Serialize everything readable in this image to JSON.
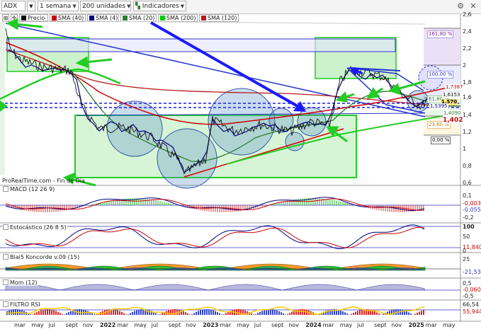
{
  "toolbar": {
    "symbol": "ADX",
    "period": "1 semana",
    "units": "200 unidades",
    "indicators": "Indicadores"
  },
  "legend": [
    {
      "label": "Precio",
      "color": "#000000"
    },
    {
      "label": "SMA (40)",
      "color": "#cc0000"
    },
    {
      "label": "SMA (4)",
      "color": "#000080"
    },
    {
      "label": "SMA (20)",
      "color": "#2e7d32"
    },
    {
      "label": "SMA (200)",
      "color": "#00cc00"
    },
    {
      "label": "SMA (120)",
      "color": "#b71c1c"
    }
  ],
  "footer": "ProRealTime.com - Fin de Día",
  "panels": {
    "macd": "MACD (12 26 9)",
    "stoch": "Estocástico (26 8 5)",
    "blai5": "Blai5 Koncorde v.09 (15)",
    "mom": "Mom (12)",
    "filtro": "FILTRO RSI"
  },
  "price_axis": [
    "2,6",
    "2,4",
    "2,2",
    "2",
    "1,8",
    "1,6",
    "1,4",
    "1,2",
    "1",
    "0,8",
    "0,6"
  ],
  "price_tags": [
    {
      "text": "1,7387",
      "color": "#cc0000",
      "bg": "#ffffff"
    },
    {
      "text": "1,6153",
      "color": "#000000",
      "bg": "#ffffff"
    },
    {
      "text": "1,570",
      "color": "#000000",
      "bg": "#ffe680"
    },
    {
      "text": "1,5395",
      "color": "#000080",
      "bg": "#ffffff"
    },
    {
      "text": "1,4090",
      "color": "#2e7d32",
      "bg": "#ffffff"
    },
    {
      "text": "1,402",
      "color": "#cc0000",
      "bg": "#ffffff"
    }
  ],
  "fib_levels": [
    "161,80 %",
    "100,00 %",
    "61,80 %",
    "23,60 %",
    "0,00 %"
  ],
  "macd_axis": [
    "0,1",
    "-0,0032",
    "-0,0558",
    "-0,2"
  ],
  "stoch_axis": [
    "100",
    "50",
    "11,840",
    "0"
  ],
  "blai5_axis": [
    "25",
    "-21,538"
  ],
  "mom_axis": [
    "0,5",
    "-0,0600",
    "-0,5"
  ],
  "filtro_axis": [
    "66,54",
    "55,944"
  ],
  "x_axis": [
    {
      "label": "mar",
      "year": false
    },
    {
      "label": "may",
      "year": false
    },
    {
      "label": "jul",
      "year": false
    },
    {
      "label": "sept",
      "year": false
    },
    {
      "label": "nov",
      "year": false
    },
    {
      "label": "2022",
      "year": true
    },
    {
      "label": "mar",
      "year": false
    },
    {
      "label": "may",
      "year": false
    },
    {
      "label": "jul",
      "year": false
    },
    {
      "label": "sept",
      "year": false
    },
    {
      "label": "nov",
      "year": false
    },
    {
      "label": "2023",
      "year": true
    },
    {
      "label": "mar",
      "year": false
    },
    {
      "label": "may",
      "year": false
    },
    {
      "label": "jul",
      "year": false
    },
    {
      "label": "sept",
      "year": false
    },
    {
      "label": "nov",
      "year": false
    },
    {
      "label": "2024",
      "year": true
    },
    {
      "label": "mar",
      "year": false
    },
    {
      "label": "may",
      "year": false
    },
    {
      "label": "jul",
      "year": false
    },
    {
      "label": "sept",
      "year": false
    },
    {
      "label": "nov",
      "year": false
    },
    {
      "label": "2025",
      "year": true
    },
    {
      "label": "mar",
      "year": false
    },
    {
      "label": "may",
      "year": false
    }
  ],
  "colors": {
    "accent_green": "#22cc22",
    "accent_blue": "#1a1aff",
    "accent_red": "#dd0000"
  }
}
